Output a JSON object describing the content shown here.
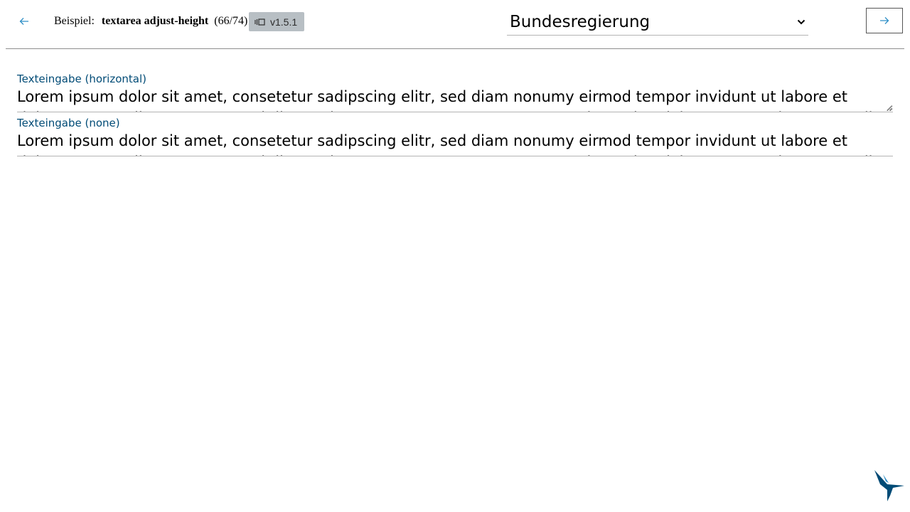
{
  "header": {
    "example_prefix": "Beispiel:",
    "example_name": "textarea adjust-height",
    "example_count": "(66/74)",
    "version": "v1.5.1",
    "theme_selected": "Bundesregierung"
  },
  "fields": [
    {
      "label": "Texteingabe (horizontal)",
      "value": "Lorem ipsum dolor sit amet, consetetur sadipscing elitr, sed diam nonumy eirmod tempor invidunt ut labore et dolore magna aliquyam erat, sed diam voluptua. At vero eos et accusam et justo duo dolores et ea rebum. Stet clita kasd"
    },
    {
      "label": "Texteingabe (none)",
      "value": "Lorem ipsum dolor sit amet, consetetur sadipscing elitr, sed diam nonumy eirmod tempor invidunt ut labore et dolore magna aliquyam erat, sed diam voluptua. At vero eos et accusam et justo duo dolores et ea rebum. Stet clita kasd"
    }
  ],
  "icons": {
    "prev": "arrow-left-icon",
    "next": "arrow-right-icon",
    "version": "component-icon",
    "select": "chevron-down-icon",
    "logo": "hummingbird-logo"
  },
  "colors": {
    "accent": "#2f8fc6",
    "label": "#004b76",
    "badge": "#b8bfc4",
    "logo": "#004b76"
  }
}
